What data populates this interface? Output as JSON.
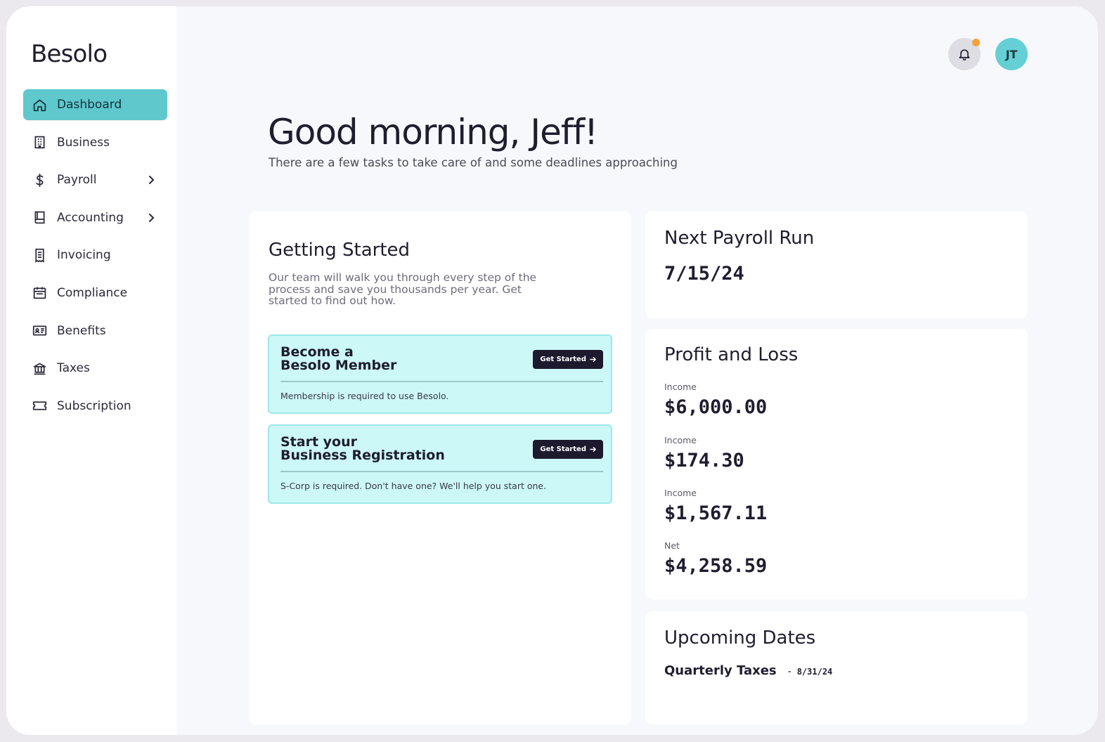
{
  "app": {
    "logo": "Besolo"
  },
  "sidebar": {
    "items": [
      {
        "label": "Dashboard",
        "icon": "home-icon",
        "active": true,
        "has_submenu": false
      },
      {
        "label": "Business",
        "icon": "building-icon",
        "active": false,
        "has_submenu": false
      },
      {
        "label": "Payroll",
        "icon": "dollar-icon",
        "active": false,
        "has_submenu": true
      },
      {
        "label": "Accounting",
        "icon": "book-icon",
        "active": false,
        "has_submenu": true
      },
      {
        "label": "Invoicing",
        "icon": "receipt-icon",
        "active": false,
        "has_submenu": false
      },
      {
        "label": "Compliance",
        "icon": "calendar-icon",
        "active": false,
        "has_submenu": false
      },
      {
        "label": "Benefits",
        "icon": "id-card-icon",
        "active": false,
        "has_submenu": false
      },
      {
        "label": "Taxes",
        "icon": "bank-icon",
        "active": false,
        "has_submenu": false
      },
      {
        "label": "Subscription",
        "icon": "ticket-icon",
        "active": false,
        "has_submenu": false
      }
    ]
  },
  "header": {
    "notification_icon": "bell-icon",
    "has_unread": true,
    "avatar_initials": "JT"
  },
  "main": {
    "greeting": "Good morning, Jeff!",
    "subtitle": "There are a few tasks to take care of and some deadlines approaching"
  },
  "getting_started": {
    "title": "Getting Started",
    "description": "Our team will walk you through every step of the process and save you thousands per year. Get started to find out how.",
    "tasks": [
      {
        "title": "Become a\nBesolo Member",
        "button": "Get Started",
        "note": "Membership is required to use Besolo."
      },
      {
        "title": "Start your\nBusiness Registration",
        "button": "Get Started",
        "note": "S-Corp is required. Don't have one? We'll help you start one."
      }
    ]
  },
  "next_payroll": {
    "title": "Next Payroll Run",
    "date": "7/15/24"
  },
  "profit_loss": {
    "title": "Profit and Loss",
    "rows": [
      {
        "label": "Income",
        "value": "$6,000.00"
      },
      {
        "label": "Income",
        "value": "$174.30"
      },
      {
        "label": "Income",
        "value": "$1,567.11"
      },
      {
        "label": "Net",
        "value": "$4,258.59"
      }
    ]
  },
  "upcoming_dates": {
    "title": "Upcoming Dates",
    "items": [
      {
        "name": "Quarterly Taxes",
        "separator": "-",
        "date": "8/31/24"
      }
    ]
  },
  "colors": {
    "accent": "#5ec8cc",
    "task_bg": "#ccf8f7",
    "button_dark": "#1d1a2e",
    "notification_dot": "#f5a23a",
    "avatar_bg": "#64cfd4"
  }
}
